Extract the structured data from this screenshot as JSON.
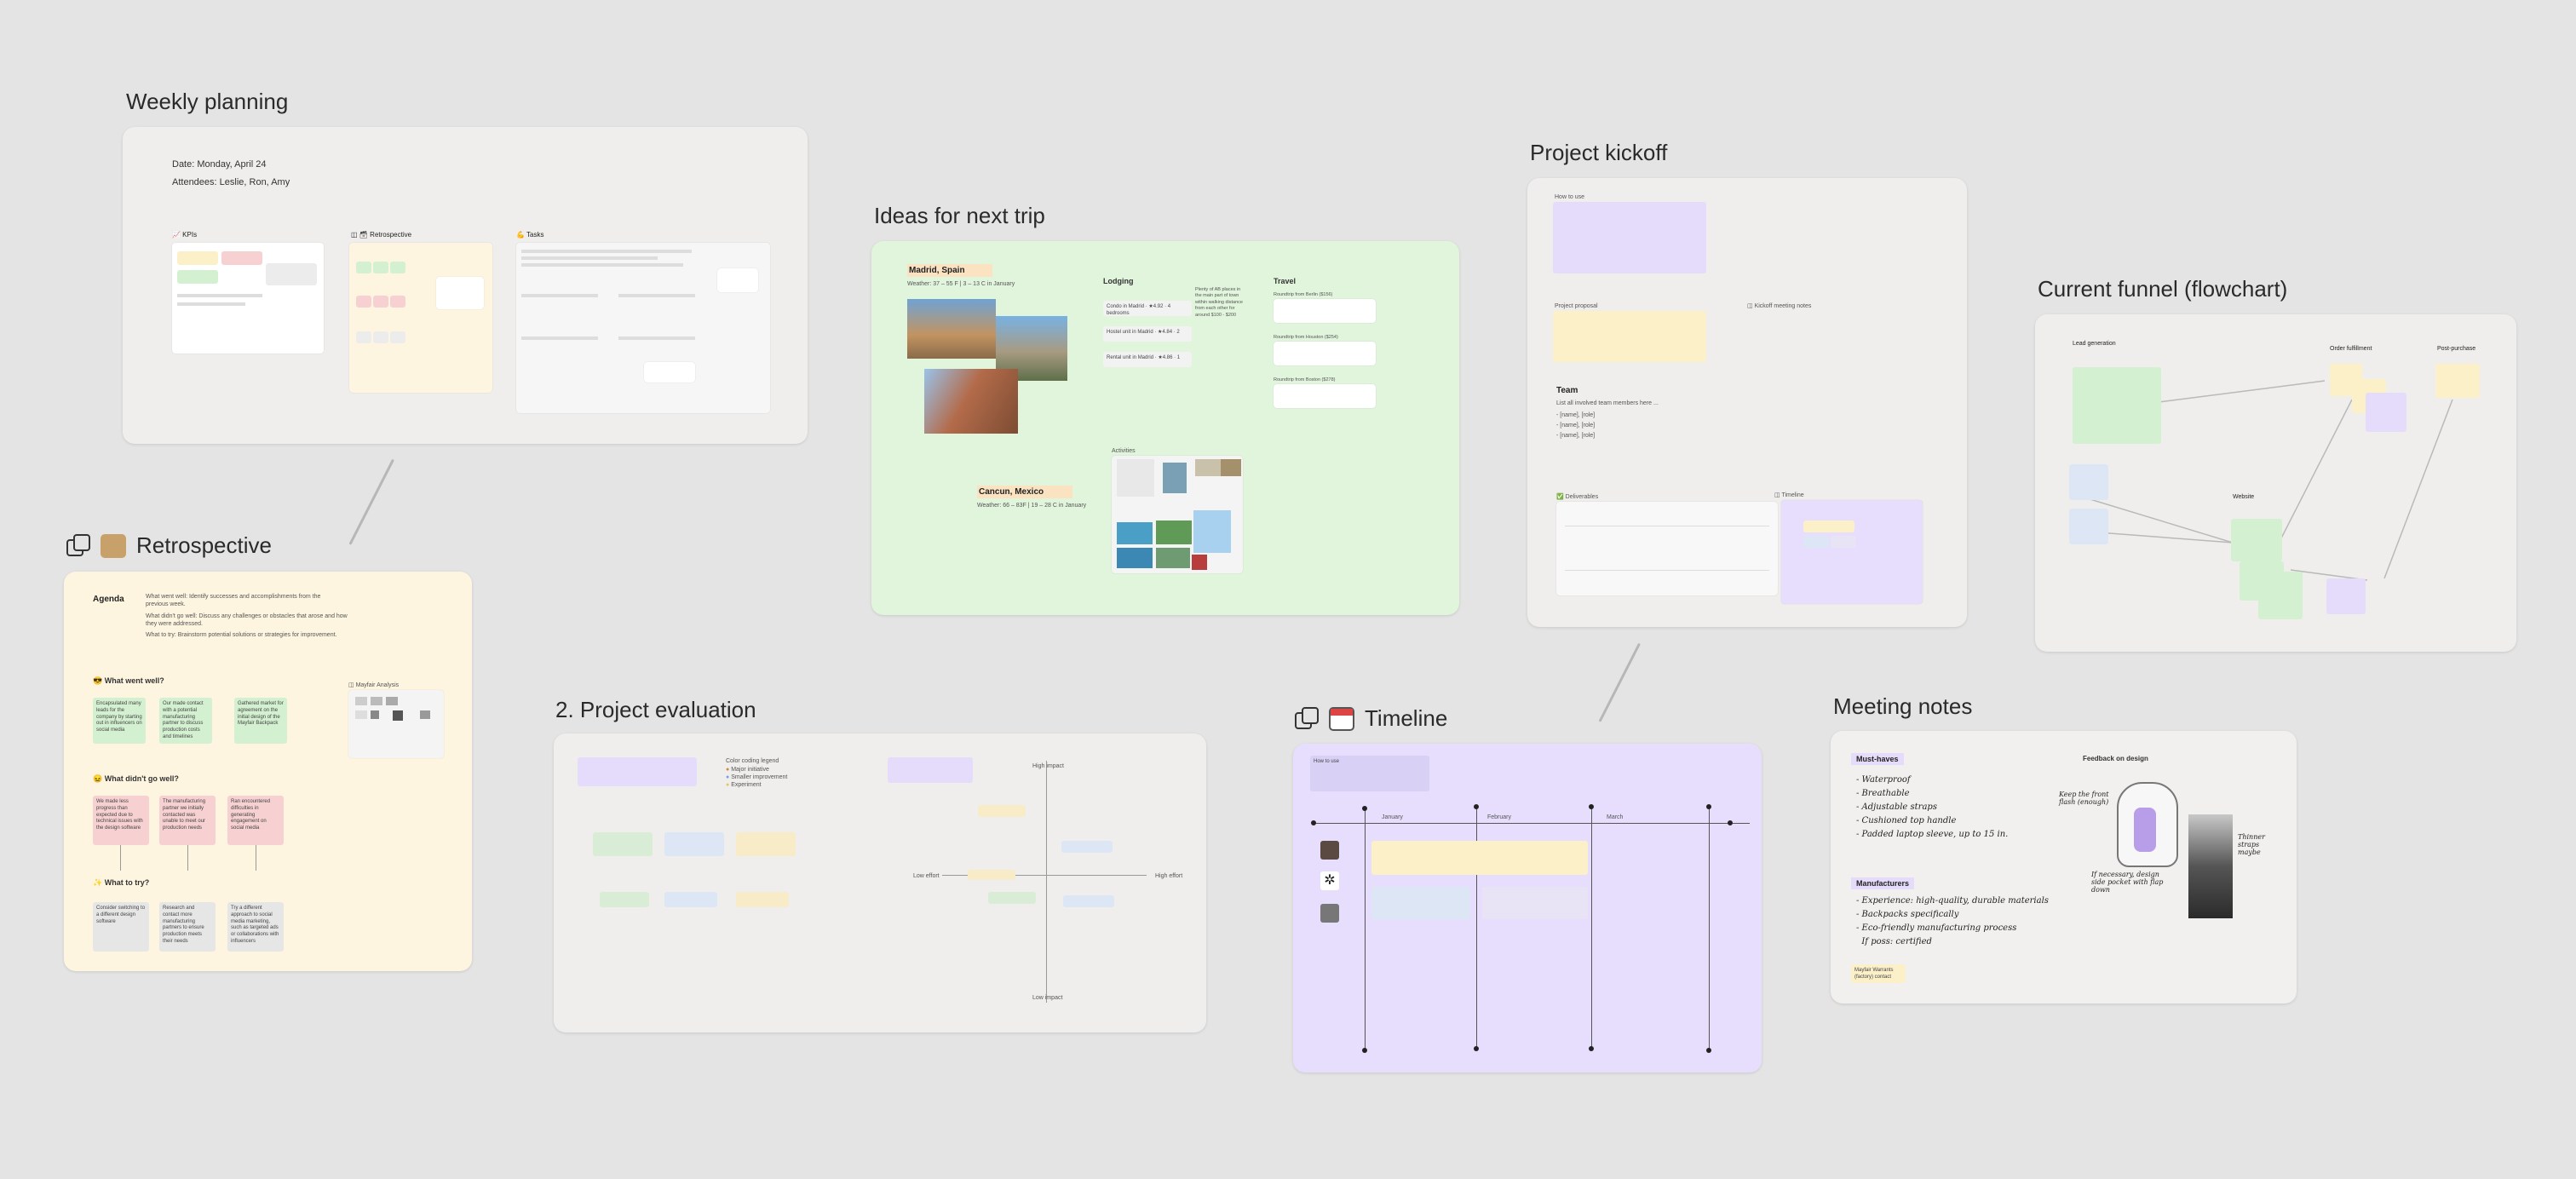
{
  "boards": {
    "weekly": {
      "title": "Weekly planning",
      "date": "Date: Monday, April 24",
      "attendees": "Attendees: Leslie, Ron, Amy",
      "sections": [
        "📈 KPIs",
        "Retrospective",
        "💪 Tasks"
      ]
    },
    "retro": {
      "title": "Retrospective",
      "agenda_label": "Agenda",
      "agenda_lines": [
        "What went well: Identify successes and accomplishments from the previous week.",
        "What didn't go well: Discuss any challenges or obstacles that arose and how they were addressed.",
        "What to try: Brainstorm potential solutions or strategies for improvement."
      ],
      "went_well": "😎 What went well?",
      "didnt_go_well": "😖 What didn't go well?",
      "to_try": "✨ What to try?",
      "mood": "Mayfair Analysis",
      "well_notes": [
        "Encapsulated many leads for the company by starting out in influencers on social media",
        "Our made contact with a potential manufacturing partner to discuss production costs and timelines",
        "Gathered market for agreement on the initial design of the Mayfair Backpack"
      ],
      "bad_notes": [
        "We made less progress than expected due to technical issues with the design software",
        "The manufacturing partner we initially contacted was unable to meet our production needs",
        "Ran encountered difficulties in generating engagement on social media"
      ],
      "try_notes": [
        "Consider switching to a different design software",
        "Research and contact more manufacturing partners to ensure production meets their needs",
        "Try a different approach to social media marketing, such as targeted ads or collaborations with influencers"
      ]
    },
    "trip": {
      "title": "Ideas for next trip",
      "city1": "Madrid, Spain",
      "weather1": "Weather: 37 – 55 F | 3 – 13 C in January",
      "city2": "Cancun, Mexico",
      "weather2": "Weather: 66 – 83F | 19 – 28 C in January",
      "lodging": "Lodging",
      "travel": "Travel",
      "activities": "Activities",
      "lodging_items": [
        "Condo in Madrid · ★4.92 · 4 bedrooms",
        "Hostel unit in Madrid · ★4.84 · 2",
        "Rental unit in Madrid · ★4.86 · 1"
      ],
      "lodging_note": "Plenty of AB places in the main part of town within walking distance from each other for around $100 - $200",
      "travel_items": [
        "Roundtrip from Berlin ($156)",
        "Roundtrip from Houston ($254)",
        "Roundtrip from Boston ($278)"
      ]
    },
    "evaluation": {
      "title": "2. Project evaluation",
      "axis_top": "High impact",
      "axis_bottom": "Low impact",
      "axis_left": "Low effort",
      "axis_right": "High effort",
      "legend": [
        "Major initiative",
        "Smaller improvement",
        "Experiment"
      ],
      "legend_title": "Color coding legend"
    },
    "kickoff": {
      "title": "Project kickoff",
      "howto": "How to use",
      "team": "Team",
      "team_intro": "List all involved team members here ...",
      "members": [
        "- [name], [role]",
        "- [name], [role]",
        "- [name], [role]"
      ],
      "proposal": "Project proposal",
      "meeting": "Kickoff meeting notes",
      "deliverables": "Deliverables",
      "timeline": "Timeline"
    },
    "timeline": {
      "title": "Timeline",
      "months": [
        "January",
        "February",
        "March"
      ],
      "note": "How to use"
    },
    "funnel": {
      "title": "Current funnel (flowchart)",
      "stages": [
        "Lead generation",
        "Order fulfillment",
        "Post-purchase",
        "Website"
      ]
    },
    "meeting": {
      "title": "Meeting notes",
      "must_haves": "Must-haves",
      "must_list": [
        "- Waterproof",
        "- Breathable",
        "- Adjustable straps",
        "- Cushioned top handle",
        "- Padded laptop sleeve, up to 15 in."
      ],
      "manufacturers": "Manufacturers",
      "manu_list": [
        "- Experience: high-quality, durable materials",
        "- Backpacks specifically",
        "- Eco-friendly manufacturing process",
        "  If poss: certified"
      ],
      "feedback": "Feedback on design",
      "annotations": [
        "Keep the front flash (enough)",
        "Thinner straps maybe",
        "If necessary, design side pocket with flap down"
      ],
      "footer": "Mayfair Warrants (factory) contact"
    }
  },
  "colors": {
    "canvas": "#e4e4e4",
    "weekly_bg": "#efeeec",
    "retro_bg": "#fdf5df",
    "trip_bg": "#e1f4dc",
    "eval_bg": "#efeeec",
    "kickoff_bg": "#efeeec",
    "timeline_bg": "#e6defc",
    "funnel_bg": "#efeeec",
    "meeting_bg": "#f1f0ee"
  }
}
